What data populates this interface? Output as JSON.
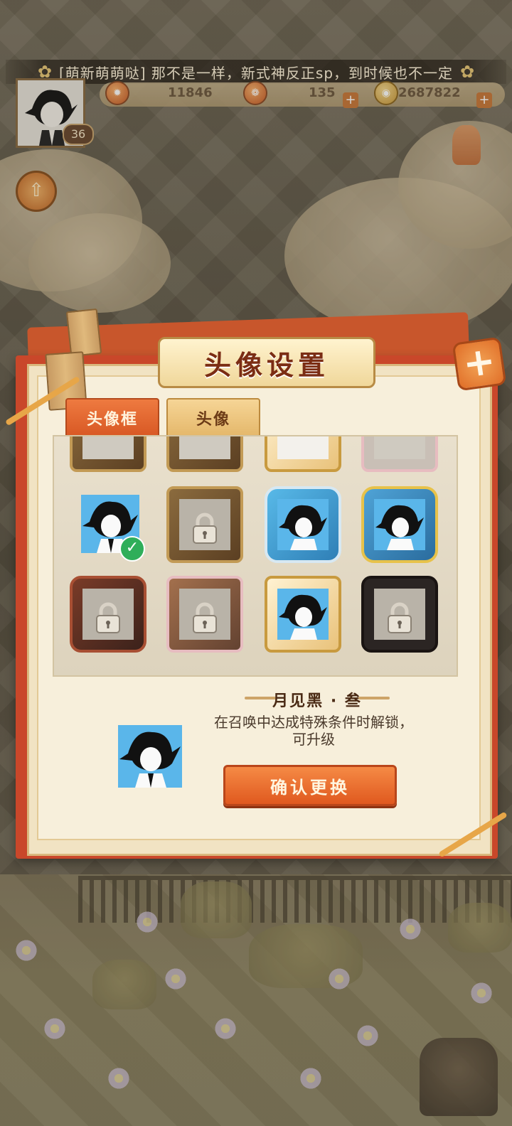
{
  "announcement": {
    "message": "[萌新萌萌哒] 那不是一样，新式神反正sp，到时候也不一定"
  },
  "player": {
    "level": "36"
  },
  "resources": [
    {
      "icon": "fire-icon",
      "value": "11846"
    },
    {
      "icon": "charm-icon",
      "value": "135"
    },
    {
      "icon": "coin-icon",
      "value": "2687822"
    }
  ],
  "dialog": {
    "title": "头像设置",
    "close_label": "+"
  },
  "tabs": [
    {
      "label": "头像框",
      "active": true
    },
    {
      "label": "头像",
      "active": false
    }
  ],
  "selected": {
    "name": "月见黑 · 叁",
    "description": "在召唤中达成特殊条件时解锁，可升级",
    "confirm_label": "确认更换"
  },
  "colors": {
    "accent": "#e06a2b",
    "panel": "#f7efdb",
    "title_text": "#7b2d14",
    "check": "#2fae5a"
  }
}
